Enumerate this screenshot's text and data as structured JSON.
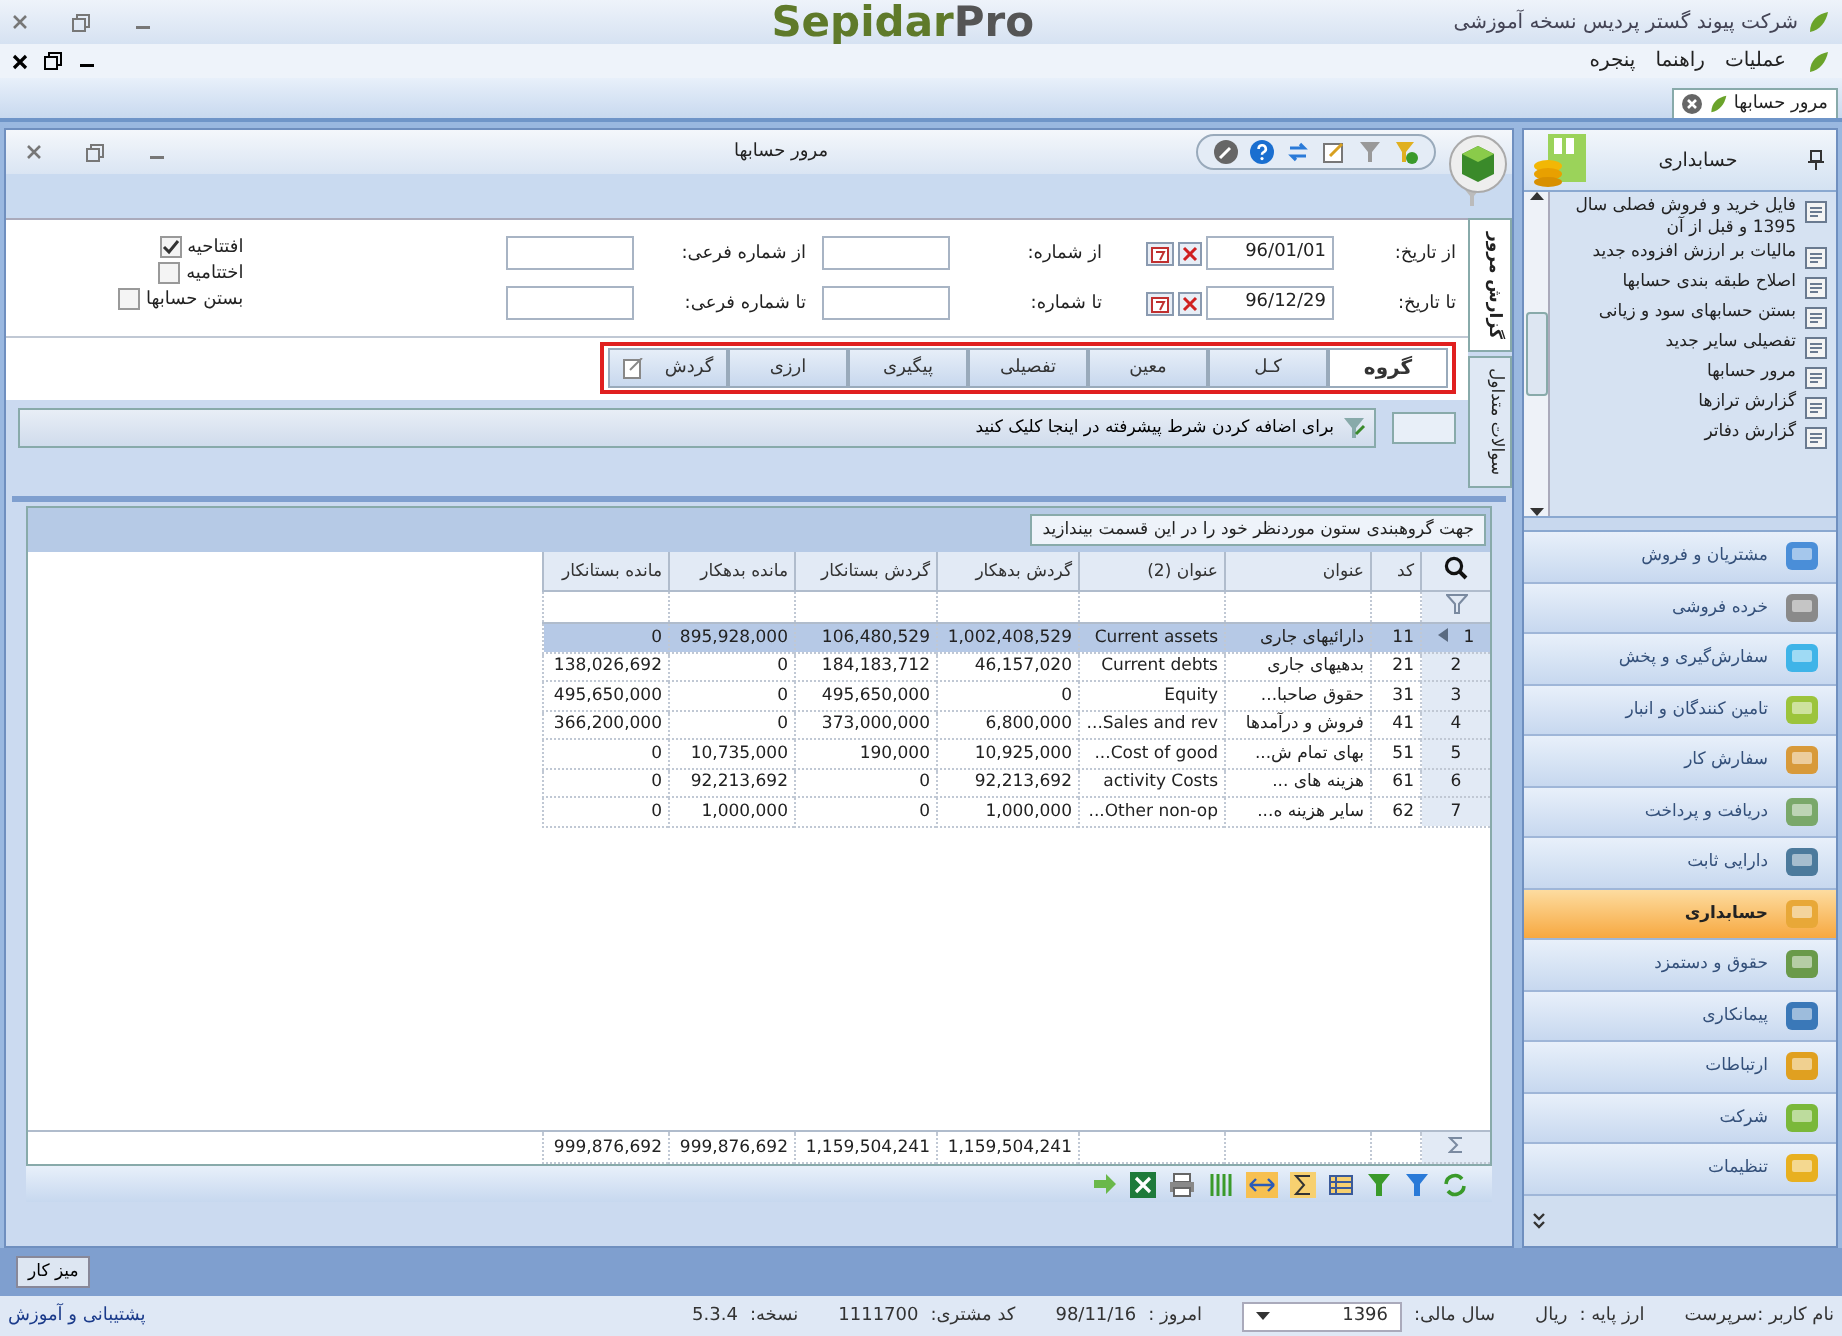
{
  "app_title": "شرکت پیوند گستر پردیس نسخه آموزشی",
  "logo": {
    "main": "Sepidar",
    "suffix": "Pro"
  },
  "menu": [
    "عملیات",
    "راهنما",
    "پنجره"
  ],
  "document_tabs": [
    {
      "label": "مرور حسابها",
      "selected": true
    }
  ],
  "report": {
    "title": "مرور حسابها",
    "filter_rows": [
      {
        "date_label": "از تاریخ:",
        "date": "96/01/01",
        "number_label": "از شماره:",
        "sub_number_label": "از شماره فرعی:"
      },
      {
        "date_label": "تا تاریخ:",
        "date": "96/12/29",
        "number_label": "تا شماره:",
        "sub_number_label": "تا شماره فرعی:"
      }
    ],
    "options": [
      {
        "label": "افتتاحیه",
        "checked": true
      },
      {
        "label": "اختتامیه",
        "checked": false
      },
      {
        "label": "بستن حسابها",
        "checked": false
      }
    ],
    "tabs": [
      {
        "label": "گروه",
        "selected": true
      },
      {
        "label": "کـل",
        "selected": false
      },
      {
        "label": "معین",
        "selected": false
      },
      {
        "label": "تفصیلی",
        "selected": false
      },
      {
        "label": "پیگیری",
        "selected": false
      },
      {
        "label": "ارزی",
        "selected": false
      },
      {
        "label": "گردش",
        "selected": false
      }
    ],
    "side_tabs": [
      {
        "label": "گزارش مرور",
        "selected": true
      },
      {
        "label": "سوالات متداول",
        "selected": false
      }
    ],
    "condition_button": "برای اضافه کردن شرط پیشرفته در اینجا کلیک کنید",
    "group_hint": "جهت گروهبندی ستون موردنظر خود را در این قسمت بیندازید",
    "table": {
      "columns": [
        "کد",
        "عنوان",
        "عنوان (2)",
        "گردش بدهکار",
        "گردش بستانکار",
        "مانده بدهکار",
        "مانده بستانکار"
      ],
      "rows": [
        {
          "number": "1",
          "selected": true,
          "cells": [
            "11",
            "دارائیهای جاری",
            "Current assets",
            "1,002,408,529",
            "106,480,529",
            "895,928,000",
            "0"
          ]
        },
        {
          "number": "2",
          "selected": false,
          "cells": [
            "21",
            "بدهیهای جاری",
            "Current debts",
            "46,157,020",
            "184,183,712",
            "0",
            "138,026,692"
          ]
        },
        {
          "number": "3",
          "selected": false,
          "cells": [
            "31",
            "حقوق صاحبا...",
            "Equity",
            "0",
            "495,650,000",
            "0",
            "495,650,000"
          ]
        },
        {
          "number": "4",
          "selected": false,
          "cells": [
            "41",
            "فروش و درآمدها",
            "Sales and rev...",
            "6,800,000",
            "373,000,000",
            "0",
            "366,200,000"
          ]
        },
        {
          "number": "5",
          "selected": false,
          "cells": [
            "51",
            "بهای تمام ش...",
            "Cost of good...",
            "10,925,000",
            "190,000",
            "10,735,000",
            "0"
          ]
        },
        {
          "number": "6",
          "selected": false,
          "cells": [
            "61",
            "هزینه های ...",
            "activity Costs",
            "92,213,692",
            "0",
            "92,213,692",
            "0"
          ]
        },
        {
          "number": "7",
          "selected": false,
          "cells": [
            "62",
            "سایر هزینه ه...",
            "Other non-op...",
            "1,000,000",
            "0",
            "1,000,000",
            "0"
          ]
        }
      ],
      "totals": [
        "1,159,504,241",
        "1,159,504,241",
        "999,876,692",
        "999,876,692"
      ]
    }
  },
  "sidebar": {
    "title": "حسابداری",
    "items": [
      "فایل خرید و فروش فصلی سال 1395 و قبل از آن",
      "مالیات بر ارزش افزوده جدید",
      "اصلاح طبقه بندی حسابها",
      "بستن حسابهای سود و زیانی",
      "تفصیلی سایر جدید",
      "مرور حسابها",
      "گزارش ترازها",
      "گزارش دفاتر"
    ],
    "modules": [
      {
        "label": "مشتریان و فروش",
        "selected": false
      },
      {
        "label": "خرده فروشی",
        "selected": false
      },
      {
        "label": "سفارش‌گیری و پخش",
        "selected": false
      },
      {
        "label": "تامین کنندگان و انبار",
        "selected": false
      },
      {
        "label": "سفارش کار",
        "selected": false
      },
      {
        "label": "دریافت و پرداخت",
        "selected": false
      },
      {
        "label": "دارایی ثابت",
        "selected": false
      },
      {
        "label": "حسابداری",
        "selected": true
      },
      {
        "label": "حقوق و دستمزد",
        "selected": false
      },
      {
        "label": "پیمانکاری",
        "selected": false
      },
      {
        "label": "ارتباطات",
        "selected": false
      },
      {
        "label": "شرکت",
        "selected": false
      },
      {
        "label": "تنظیمات",
        "selected": false
      }
    ]
  },
  "taskbar": [
    "میز کار"
  ],
  "status_bar": {
    "user": "نام کاربر :سرپرست",
    "base_currency_label": "ارز پایه :",
    "base_currency": "ریال",
    "fiscal_year_label": "سال مالی:",
    "fiscal_year": "1396",
    "today_label": "امروز :",
    "today": "98/11/16",
    "customer_code_label": "کد مشتری:",
    "customer_code": "1111700",
    "version_label": "نسخه:",
    "version": "5.3.4",
    "support_link": "پشتیبانی و آموزش"
  }
}
